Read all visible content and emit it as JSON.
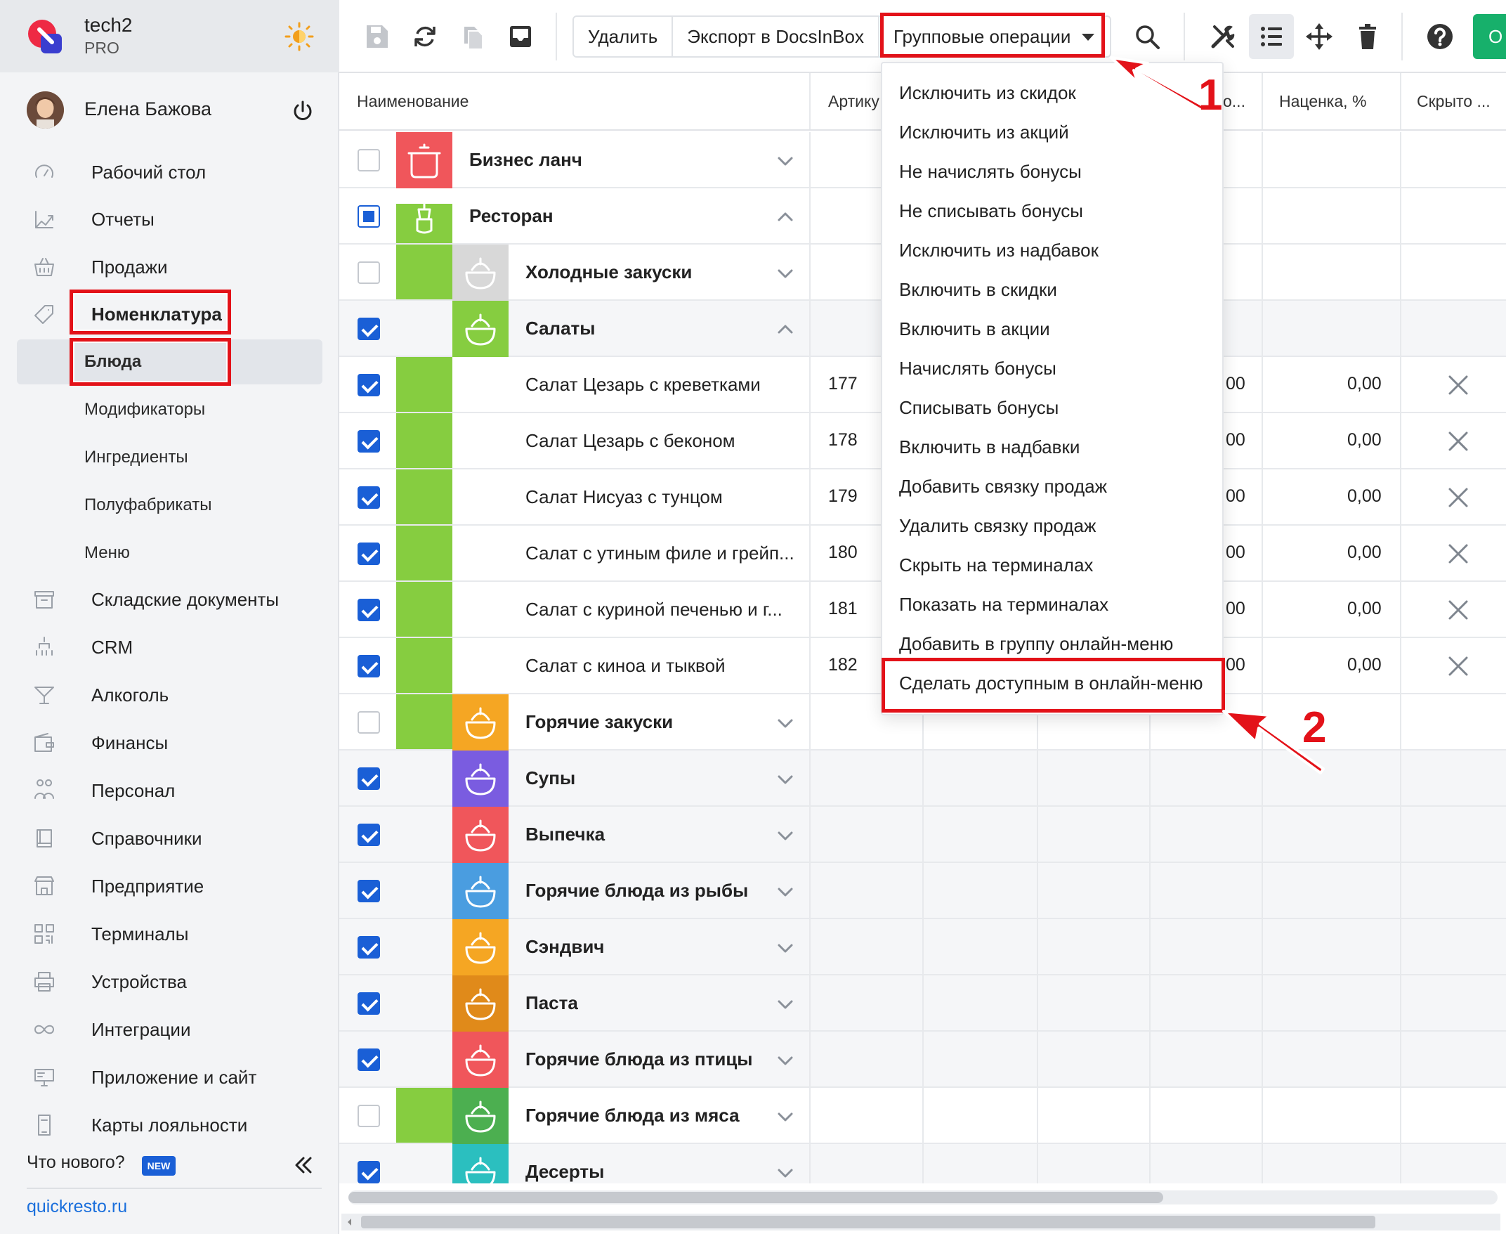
{
  "colors": {
    "accent": "#1a5fd6",
    "highlight": "#e31219",
    "restaurant_strip": "#86cd40",
    "green_button": "#17b06b"
  },
  "brand": {
    "name": "tech2",
    "plan": "PRO"
  },
  "user": {
    "name": "Елена Бажова"
  },
  "sidebar": {
    "items": [
      {
        "label": "Рабочий стол",
        "icon": "dashboard-icon"
      },
      {
        "label": "Отчеты",
        "icon": "chart-icon"
      },
      {
        "label": "Продажи",
        "icon": "basket-icon"
      },
      {
        "label": "Номенклатура",
        "icon": "tag-icon"
      },
      {
        "label": "Складские документы",
        "icon": "box-icon"
      },
      {
        "label": "CRM",
        "icon": "hierarchy-icon"
      },
      {
        "label": "Алкоголь",
        "icon": "cocktail-icon"
      },
      {
        "label": "Финансы",
        "icon": "wallet-icon"
      },
      {
        "label": "Персонал",
        "icon": "people-icon"
      },
      {
        "label": "Справочники",
        "icon": "book-icon"
      },
      {
        "label": "Предприятие",
        "icon": "store-icon"
      },
      {
        "label": "Терминалы",
        "icon": "qr-icon"
      },
      {
        "label": "Устройства",
        "icon": "printer-icon"
      },
      {
        "label": "Интеграции",
        "icon": "infinity-icon"
      },
      {
        "label": "Приложение и сайт",
        "icon": "monitor-icon"
      },
      {
        "label": "Карты лояльности",
        "icon": "phone-icon"
      }
    ],
    "subitems": [
      "Блюда",
      "Модификаторы",
      "Ингредиенты",
      "Полуфабрикаты",
      "Меню"
    ],
    "whats_new": "Что нового?",
    "new_badge": "NEW",
    "site": "quickresto.ru"
  },
  "toolbar": {
    "delete": "Удалить",
    "export": "Экспорт в DocsInBox",
    "group_ops": "Групповые операции",
    "green_btn": "О"
  },
  "table": {
    "headers": {
      "name": "Наименование",
      "article": "Артику",
      "col_o": "о...",
      "markup": "Наценка, %",
      "hidden": "Скрыто ..."
    },
    "rows": [
      {
        "name": "Бизнес ланч",
        "level": 0,
        "checked": "off",
        "chev": "down"
      },
      {
        "name": "Ресторан",
        "level": 0,
        "checked": "partial",
        "chev": "up"
      },
      {
        "name": "Холодные закуски",
        "level": 1,
        "checked": "off",
        "chev": "down"
      },
      {
        "name": "Салаты",
        "level": 1,
        "checked": "on",
        "chev": "up"
      },
      {
        "name": "Салат Цезарь с креветками",
        "level": 2,
        "checked": "on",
        "article": "177",
        "col_o": "00",
        "markup": "0,00"
      },
      {
        "name": "Салат Цезарь с беконом",
        "level": 2,
        "checked": "on",
        "article": "178",
        "col_o": "00",
        "markup": "0,00"
      },
      {
        "name": "Салат Нисуаз с тунцом",
        "level": 2,
        "checked": "on",
        "article": "179",
        "col_o": "00",
        "markup": "0,00"
      },
      {
        "name": "Салат с утиным филе и грейп...",
        "level": 2,
        "checked": "on",
        "article": "180",
        "col_o": "00",
        "markup": "0,00"
      },
      {
        "name": "Салат с куриной печенью и г...",
        "level": 2,
        "checked": "on",
        "article": "181",
        "col_o": "00",
        "markup": "0,00"
      },
      {
        "name": "Салат с киноа и тыквой",
        "level": 2,
        "checked": "on",
        "article": "182",
        "col_o": "00",
        "markup": "0,00"
      },
      {
        "name": "Горячие закуски",
        "level": 1,
        "checked": "off",
        "chev": "down"
      },
      {
        "name": "Супы",
        "level": 1,
        "checked": "on",
        "chev": "down"
      },
      {
        "name": "Выпечка",
        "level": 1,
        "checked": "on",
        "chev": "down"
      },
      {
        "name": "Горячие блюда из рыбы",
        "level": 1,
        "checked": "on",
        "chev": "down"
      },
      {
        "name": "Сэндвич",
        "level": 1,
        "checked": "on",
        "chev": "down"
      },
      {
        "name": "Паста",
        "level": 1,
        "checked": "on",
        "chev": "down"
      },
      {
        "name": "Горячие блюда из птицы",
        "level": 1,
        "checked": "on",
        "chev": "down"
      },
      {
        "name": "Горячие блюда из мяса",
        "level": 1,
        "checked": "off",
        "chev": "down"
      },
      {
        "name": "Десерты",
        "level": 1,
        "checked": "on",
        "chev": "down"
      }
    ]
  },
  "group_menu": {
    "items": [
      "Исключить из скидок",
      "Исключить из акций",
      "Не начислять бонусы",
      "Не списывать бонусы",
      "Исключить из надбавок",
      "Включить в скидки",
      "Включить в акции",
      "Начислять бонусы",
      "Списывать бонусы",
      "Включить в надбавки",
      "Добавить связку продаж",
      "Удалить связку продаж",
      "Скрыть на терминалах",
      "Показать на терминалах",
      "Добавить в группу онлайн-меню",
      "Сделать доступным в онлайн-меню"
    ]
  },
  "callouts": [
    "1",
    "2"
  ]
}
